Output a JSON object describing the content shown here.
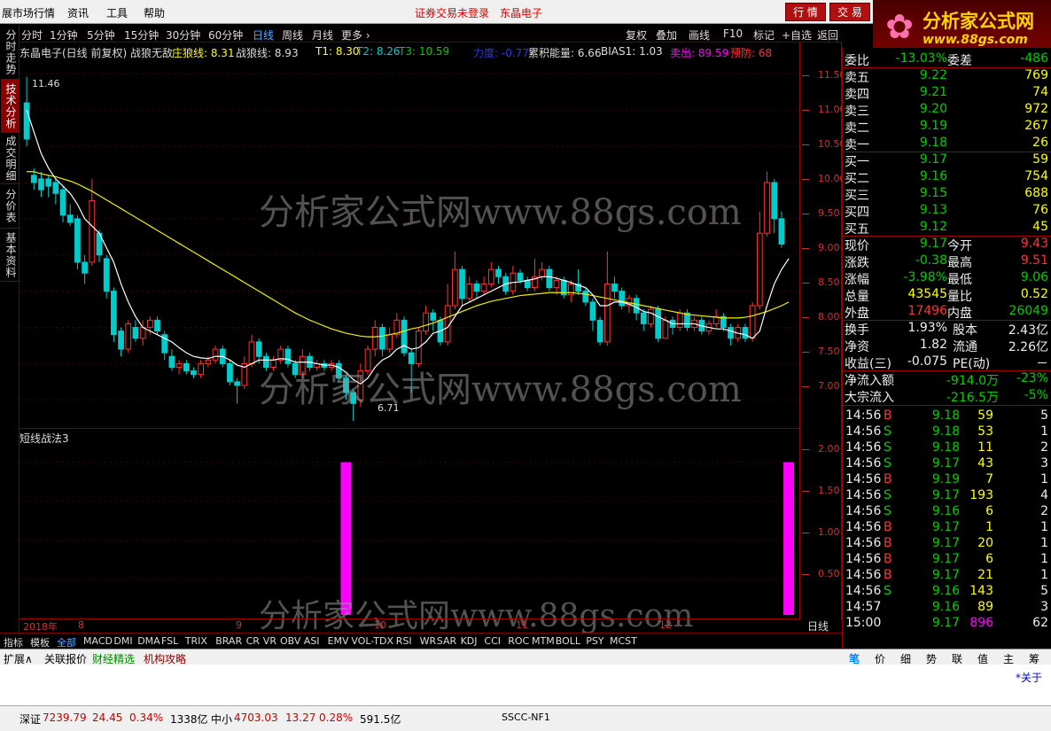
{
  "menubar": {
    "app_title": "展市场行情",
    "items": [
      "资讯",
      "工具",
      "帮助"
    ],
    "warn1": "证券交易未登录",
    "warn2": "东晶电子",
    "btn_quote": "行 情",
    "btn_trade": "交 易"
  },
  "logo": {
    "line1": "分析家公式网",
    "line2": "www.88gs.com"
  },
  "periods": [
    "分时",
    "1分钟",
    "5分钟",
    "15分钟",
    "30分钟",
    "60分钟",
    "日线",
    "周线",
    "月线",
    "更多 ›"
  ],
  "period_active": "日线",
  "tools": [
    "复权",
    "叠加",
    "画线",
    "F10",
    "标记",
    "+自选",
    "返回"
  ],
  "lefttabs": [
    "分时走势",
    "技术分析",
    "成交明细",
    "分价表",
    "基本资料"
  ],
  "lefttab_active": "技术分析",
  "legend": {
    "title": "东晶电子(日线 前复权) 战狼无敌",
    "z_label": "庄狼线: 8.31",
    "zl_label": "战狼线: 8.93",
    "t1": "T1: 8.30",
    "t2": "T2: 8.26",
    "t3": "T3: 10.59",
    "li": "力度: -0.77",
    "lj": "累积能量: 6.66",
    "bias": "BIAS1: 1.03",
    "sell": "卖出: 89.59",
    "warn": "预防: 68"
  },
  "chart": {
    "high_label": "11.46",
    "low_label": "6.71",
    "yticks": [
      "11.50",
      "11.00",
      "10.50",
      "10.00",
      "9.50",
      "9.00",
      "8.50",
      "8.00",
      "7.50",
      "7.00"
    ],
    "sub_title": "短线战法3",
    "sub_yticks": [
      "2.00",
      "1.50",
      "1.00",
      "0.50"
    ]
  },
  "chart_data": {
    "type": "candlestick",
    "ylim": [
      6.6,
      11.7
    ],
    "candles": [
      [
        11.1,
        10.6,
        11.46,
        10.5
      ],
      [
        10.1,
        10.0,
        10.2,
        9.9
      ],
      [
        10.05,
        9.9,
        10.15,
        9.8
      ],
      [
        10.05,
        9.95,
        10.1,
        9.8
      ],
      [
        10.0,
        9.85,
        10.05,
        9.7
      ],
      [
        9.9,
        9.55,
        9.95,
        9.45
      ],
      [
        9.55,
        9.45,
        9.7,
        9.4
      ],
      [
        9.5,
        8.9,
        9.55,
        8.8
      ],
      [
        8.9,
        8.75,
        9.0,
        8.6
      ],
      [
        8.9,
        9.75,
        10.05,
        8.85
      ],
      [
        9.3,
        9.0,
        9.35,
        8.9
      ],
      [
        8.95,
        8.5,
        9.0,
        8.4
      ],
      [
        8.5,
        7.9,
        8.55,
        7.8
      ],
      [
        7.95,
        7.7,
        8.0,
        7.6
      ],
      [
        7.7,
        8.05,
        8.1,
        7.65
      ],
      [
        8.0,
        7.85,
        8.1,
        7.8
      ],
      [
        7.85,
        8.0,
        8.1,
        7.75
      ],
      [
        8.0,
        8.1,
        8.15,
        7.9
      ],
      [
        8.1,
        7.95,
        8.15,
        7.9
      ],
      [
        7.9,
        7.65,
        7.95,
        7.55
      ],
      [
        7.6,
        7.45,
        7.7,
        7.4
      ],
      [
        7.45,
        7.5,
        7.55,
        7.35
      ],
      [
        7.5,
        7.4,
        7.55,
        7.35
      ],
      [
        7.4,
        7.35,
        7.45,
        7.3
      ],
      [
        7.35,
        7.5,
        7.55,
        7.3
      ],
      [
        7.5,
        7.55,
        7.6,
        7.45
      ],
      [
        7.55,
        7.7,
        7.75,
        7.5
      ],
      [
        7.7,
        7.5,
        7.75,
        7.45
      ],
      [
        7.5,
        7.25,
        7.55,
        7.2
      ],
      [
        7.25,
        7.2,
        7.3,
        6.95
      ],
      [
        7.2,
        7.5,
        7.6,
        7.15
      ],
      [
        7.5,
        7.8,
        7.9,
        7.45
      ],
      [
        7.8,
        7.6,
        7.85,
        7.5
      ],
      [
        7.6,
        7.45,
        7.65,
        7.4
      ],
      [
        7.45,
        7.55,
        7.6,
        7.4
      ],
      [
        7.55,
        7.7,
        7.75,
        7.5
      ],
      [
        7.7,
        7.5,
        7.75,
        7.45
      ],
      [
        7.5,
        7.35,
        7.55,
        7.3
      ],
      [
        7.35,
        7.6,
        7.7,
        7.3
      ],
      [
        7.6,
        7.45,
        7.65,
        7.4
      ],
      [
        7.45,
        7.5,
        7.55,
        7.4
      ],
      [
        7.5,
        7.45,
        7.55,
        7.4
      ],
      [
        7.45,
        7.5,
        7.55,
        7.4
      ],
      [
        7.5,
        7.3,
        7.55,
        7.25
      ],
      [
        7.3,
        7.1,
        7.35,
        7.0
      ],
      [
        7.1,
        6.95,
        7.15,
        6.71
      ],
      [
        7.0,
        7.4,
        7.5,
        6.9
      ],
      [
        7.4,
        7.7,
        7.75,
        7.35
      ],
      [
        7.7,
        8.0,
        8.1,
        7.6
      ],
      [
        8.0,
        7.7,
        8.05,
        7.6
      ],
      [
        7.7,
        7.9,
        8.0,
        7.65
      ],
      [
        7.9,
        8.1,
        8.2,
        7.85
      ],
      [
        8.1,
        7.65,
        8.15,
        7.6
      ],
      [
        7.65,
        7.5,
        7.7,
        7.1
      ],
      [
        7.5,
        7.95,
        8.0,
        7.45
      ],
      [
        7.95,
        8.2,
        8.3,
        7.9
      ],
      [
        8.2,
        8.1,
        8.25,
        7.95
      ],
      [
        8.1,
        7.8,
        8.15,
        7.75
      ],
      [
        7.8,
        8.3,
        8.6,
        7.75
      ],
      [
        8.3,
        8.8,
        9.05,
        8.25
      ],
      [
        8.8,
        8.4,
        8.85,
        8.3
      ],
      [
        8.4,
        8.6,
        8.7,
        8.35
      ],
      [
        8.6,
        8.5,
        8.65,
        8.4
      ],
      [
        8.5,
        8.6,
        8.7,
        8.45
      ],
      [
        8.6,
        8.8,
        8.9,
        8.55
      ],
      [
        8.8,
        8.7,
        8.85,
        8.6
      ],
      [
        8.7,
        8.5,
        8.75,
        8.45
      ],
      [
        8.5,
        8.75,
        8.85,
        8.45
      ],
      [
        8.75,
        8.65,
        8.8,
        8.6
      ],
      [
        8.65,
        8.55,
        8.7,
        8.5
      ],
      [
        8.55,
        8.7,
        8.95,
        8.5
      ],
      [
        8.7,
        8.8,
        8.9,
        8.65
      ],
      [
        8.8,
        8.55,
        8.85,
        8.5
      ],
      [
        8.55,
        8.65,
        8.7,
        8.45
      ],
      [
        8.65,
        8.45,
        8.7,
        8.4
      ],
      [
        8.45,
        8.6,
        8.65,
        8.35
      ],
      [
        8.6,
        8.5,
        8.8,
        8.45
      ],
      [
        8.5,
        8.35,
        8.55,
        8.3
      ],
      [
        8.35,
        8.1,
        8.4,
        7.95
      ],
      [
        8.1,
        7.8,
        8.15,
        7.75
      ],
      [
        7.8,
        8.6,
        9.05,
        7.75
      ],
      [
        8.6,
        8.5,
        8.7,
        8.4
      ],
      [
        8.5,
        8.3,
        8.55,
        8.25
      ],
      [
        8.3,
        8.4,
        8.45,
        8.2
      ],
      [
        8.4,
        8.2,
        8.45,
        8.1
      ],
      [
        8.2,
        8.05,
        8.25,
        7.95
      ],
      [
        8.05,
        8.25,
        8.3,
        8.0
      ],
      [
        8.25,
        7.85,
        8.3,
        7.8
      ],
      [
        7.85,
        8.1,
        8.15,
        7.85
      ],
      [
        8.1,
        8.0,
        8.15,
        7.9
      ],
      [
        8.0,
        8.2,
        8.25,
        7.95
      ],
      [
        8.2,
        8.0,
        8.25,
        7.95
      ],
      [
        8.0,
        8.1,
        8.15,
        7.95
      ],
      [
        8.1,
        7.95,
        8.15,
        7.9
      ],
      [
        7.95,
        8.05,
        8.1,
        7.9
      ],
      [
        8.05,
        8.15,
        8.25,
        8.0
      ],
      [
        8.15,
        8.0,
        8.2,
        7.95
      ],
      [
        8.0,
        7.85,
        8.05,
        7.75
      ],
      [
        7.85,
        8.0,
        8.05,
        7.8
      ],
      [
        8.0,
        7.85,
        8.05,
        7.8
      ],
      [
        7.85,
        8.3,
        8.35,
        7.8
      ],
      [
        8.3,
        9.3,
        9.6,
        8.25
      ],
      [
        9.3,
        10.0,
        10.15,
        9.25
      ],
      [
        10.0,
        9.5,
        10.05,
        9.3
      ],
      [
        9.5,
        9.15,
        9.6,
        9.1
      ]
    ],
    "ma_white": [
      11.0,
      10.7,
      10.4,
      10.2,
      10.05,
      9.95,
      9.85,
      9.7,
      9.5,
      9.4,
      9.3,
      9.1,
      8.9,
      8.6,
      8.35,
      8.15,
      8.0,
      7.95,
      7.9,
      7.85,
      7.8,
      7.72,
      7.65,
      7.6,
      7.58,
      7.57,
      7.6,
      7.6,
      7.55,
      7.48,
      7.45,
      7.5,
      7.55,
      7.55,
      7.55,
      7.57,
      7.56,
      7.52,
      7.52,
      7.52,
      7.5,
      7.48,
      7.48,
      7.45,
      7.38,
      7.28,
      7.22,
      7.3,
      7.45,
      7.55,
      7.6,
      7.7,
      7.75,
      7.7,
      7.72,
      7.8,
      7.92,
      7.95,
      8.0,
      8.15,
      8.3,
      8.35,
      8.4,
      8.45,
      8.5,
      8.55,
      8.6,
      8.62,
      8.63,
      8.65,
      8.67,
      8.7,
      8.7,
      8.68,
      8.65,
      8.62,
      8.58,
      8.55,
      8.45,
      8.3,
      8.3,
      8.35,
      8.35,
      8.32,
      8.28,
      8.22,
      8.2,
      8.15,
      8.1,
      8.05,
      8.05,
      8.05,
      8.05,
      8.02,
      8.0,
      7.98,
      7.98,
      7.95,
      7.92,
      7.9,
      7.85,
      7.95,
      8.3,
      8.6,
      8.8,
      8.95
    ],
    "ma_yellow": [
      10.15,
      10.15,
      10.12,
      10.1,
      10.08,
      10.05,
      10.02,
      9.98,
      9.93,
      9.88,
      9.82,
      9.76,
      9.7,
      9.64,
      9.58,
      9.52,
      9.46,
      9.4,
      9.34,
      9.28,
      9.22,
      9.16,
      9.1,
      9.04,
      8.98,
      8.92,
      8.86,
      8.8,
      8.74,
      8.68,
      8.62,
      8.56,
      8.5,
      8.44,
      8.38,
      8.32,
      8.26,
      8.2,
      8.15,
      8.1,
      8.06,
      8.02,
      7.98,
      7.95,
      7.92,
      7.9,
      7.88,
      7.87,
      7.87,
      7.88,
      7.9,
      7.92,
      7.95,
      7.98,
      8.0,
      8.03,
      8.06,
      8.1,
      8.14,
      8.18,
      8.22,
      8.26,
      8.3,
      8.33,
      8.36,
      8.38,
      8.4,
      8.42,
      8.44,
      8.45,
      8.46,
      8.47,
      8.48,
      8.48,
      8.48,
      8.48,
      8.47,
      8.46,
      8.44,
      8.42,
      8.4,
      8.38,
      8.36,
      8.34,
      8.32,
      8.3,
      8.28,
      8.26,
      8.24,
      8.22,
      8.2,
      8.18,
      8.17,
      8.16,
      8.15,
      8.14,
      8.13,
      8.13,
      8.13,
      8.14,
      8.16,
      8.19,
      8.22,
      8.26,
      8.3,
      8.35
    ],
    "signals": [
      {
        "i": 44,
        "v": 2.0
      },
      {
        "i": 105,
        "v": 2.0
      }
    ]
  },
  "dateaxis": [
    "2018年",
    "8",
    "9",
    "10",
    "11",
    "12"
  ],
  "indicators": [
    "指标",
    "模板",
    "全部",
    "MACD",
    "DMI",
    "DMA",
    "FSL",
    "TRIX",
    "BRAR",
    "CR",
    "VR",
    "OBV",
    "ASI",
    "EMV",
    "VOL-TDX",
    "RSI",
    "WR",
    "SAR",
    "KDJ",
    "CCI",
    "ROC",
    "MTM",
    "BOLL",
    "PSY",
    "MCST"
  ],
  "indicator_active": "全部",
  "bottomtabs": [
    "扩展∧",
    "关联报价",
    "财经精选",
    "机构攻略"
  ],
  "axis_label": "日线",
  "quote": {
    "weibi_l": "委比",
    "weibi_v": "-13.03%",
    "weicha_l": "委差",
    "weicha_v": "-486",
    "sells": [
      {
        "l": "卖五",
        "p": "9.22",
        "v": "769"
      },
      {
        "l": "卖四",
        "p": "9.21",
        "v": "74"
      },
      {
        "l": "卖三",
        "p": "9.20",
        "v": "972"
      },
      {
        "l": "卖二",
        "p": "9.19",
        "v": "267"
      },
      {
        "l": "卖一",
        "p": "9.18",
        "v": "26"
      }
    ],
    "buys": [
      {
        "l": "买一",
        "p": "9.17",
        "v": "59"
      },
      {
        "l": "买二",
        "p": "9.16",
        "v": "754"
      },
      {
        "l": "买三",
        "p": "9.15",
        "v": "688"
      },
      {
        "l": "买四",
        "p": "9.13",
        "v": "76"
      },
      {
        "l": "买五",
        "p": "9.12",
        "v": "45"
      }
    ],
    "stats": [
      {
        "l1": "现价",
        "v1": "9.17",
        "l2": "今开",
        "v2": "9.43"
      },
      {
        "l1": "涨跌",
        "v1": "-0.38",
        "l2": "最高",
        "v2": "9.51"
      },
      {
        "l1": "涨幅",
        "v1": "-3.98%",
        "l2": "最低",
        "v2": "9.06"
      },
      {
        "l1": "总量",
        "v1": "43545",
        "l2": "量比",
        "v2": "0.52"
      },
      {
        "l1": "外盘",
        "v1": "17496",
        "l2": "内盘",
        "v2": "26049"
      }
    ],
    "stats2": [
      {
        "l1": "换手",
        "v1": "1.93%",
        "l2": "股本",
        "v2": "2.43亿"
      },
      {
        "l1": "净资",
        "v1": "1.82",
        "l2": "流通",
        "v2": "2.26亿"
      },
      {
        "l1": "收益(三)",
        "v1": "-0.075",
        "l2": "PE(动)",
        "v2": "－"
      }
    ],
    "flows": [
      {
        "l": "净流入额",
        "v": "-914.0万",
        "p": "-23%"
      },
      {
        "l": "大宗流入",
        "v": "-216.5万",
        "p": "-5%"
      }
    ],
    "ticks": [
      {
        "t": "14:56",
        "p": "9.18",
        "v": "59",
        "s": "B",
        "n": "5"
      },
      {
        "t": "14:56",
        "p": "9.18",
        "v": "53",
        "s": "S",
        "n": "1"
      },
      {
        "t": "14:56",
        "p": "9.18",
        "v": "11",
        "s": "S",
        "n": "2"
      },
      {
        "t": "14:56",
        "p": "9.17",
        "v": "43",
        "s": "S",
        "n": "3"
      },
      {
        "t": "14:56",
        "p": "9.19",
        "v": "7",
        "s": "B",
        "n": "1"
      },
      {
        "t": "14:56",
        "p": "9.17",
        "v": "193",
        "s": "S",
        "n": "4"
      },
      {
        "t": "14:56",
        "p": "9.16",
        "v": "6",
        "s": "S",
        "n": "2"
      },
      {
        "t": "14:56",
        "p": "9.17",
        "v": "1",
        "s": "B",
        "n": "1"
      },
      {
        "t": "14:56",
        "p": "9.17",
        "v": "20",
        "s": "B",
        "n": "1"
      },
      {
        "t": "14:56",
        "p": "9.17",
        "v": "6",
        "s": "B",
        "n": "1"
      },
      {
        "t": "14:56",
        "p": "9.17",
        "v": "21",
        "s": "B",
        "n": "1"
      },
      {
        "t": "14:56",
        "p": "9.16",
        "v": "143",
        "s": "S",
        "n": "5"
      },
      {
        "t": "14:57",
        "p": "9.16",
        "v": "89",
        "s": "",
        "n": "3"
      },
      {
        "t": "15:00",
        "p": "9.17",
        "v": "896",
        "s": "",
        "n": "62"
      }
    ]
  },
  "righttabs": [
    "笔",
    "价",
    "细",
    "势",
    "联",
    "值",
    "主",
    "筹"
  ],
  "about": "*关于",
  "status": {
    "sz_label": "深证",
    "sz_v": "7239.79",
    "sz_c": "24.45",
    "sz_p": "0.34%",
    "sz_amt": "1338亿",
    "zx_label": "中小",
    "zx_v": "4703.03",
    "zx_c": "13.27",
    "zx_p": "0.28%",
    "zx_amt": "591.5亿",
    "conn": "SSCC-NF1"
  },
  "watermark": "分析家公式网www.88gs.com"
}
